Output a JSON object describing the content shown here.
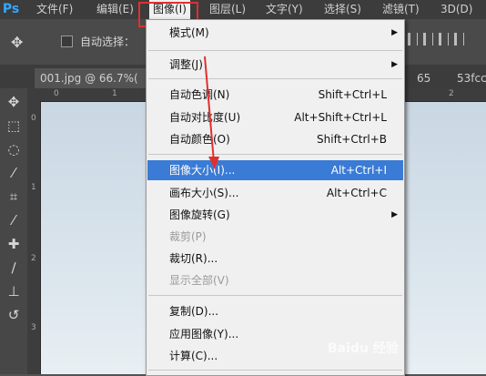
{
  "menubar": {
    "logo": "Ps",
    "items": [
      {
        "label": "文件(F)"
      },
      {
        "label": "编辑(E)"
      },
      {
        "label": "图像(I)"
      },
      {
        "label": "图层(L)"
      },
      {
        "label": "文字(Y)"
      },
      {
        "label": "选择(S)"
      },
      {
        "label": "滤镜(T)"
      },
      {
        "label": "3D(D)"
      }
    ]
  },
  "options": {
    "auto_select_label": "自动选择："
  },
  "tabs": {
    "doc_tab": "001.jpg @ 66.7%(",
    "other1": "65",
    "other2": "53fcc"
  },
  "rulers": {
    "top": [
      "0",
      "1",
      "2"
    ],
    "left": [
      "0",
      "1",
      "2",
      "3"
    ]
  },
  "image_menu": {
    "items": [
      {
        "label": "模式(M)",
        "shortcut": "",
        "submenu": true
      },
      {
        "label": "调整(J)",
        "shortcut": "",
        "submenu": true
      },
      {
        "label": "自动色调(N)",
        "shortcut": "Shift+Ctrl+L"
      },
      {
        "label": "自动对比度(U)",
        "shortcut": "Alt+Shift+Ctrl+L"
      },
      {
        "label": "自动颜色(O)",
        "shortcut": "Shift+Ctrl+B"
      },
      {
        "label": "图像大小(I)...",
        "shortcut": "Alt+Ctrl+I"
      },
      {
        "label": "画布大小(S)...",
        "shortcut": "Alt+Ctrl+C"
      },
      {
        "label": "图像旋转(G)",
        "shortcut": "",
        "submenu": true
      },
      {
        "label": "裁剪(P)",
        "shortcut": ""
      },
      {
        "label": "裁切(R)...",
        "shortcut": ""
      },
      {
        "label": "显示全部(V)",
        "shortcut": ""
      },
      {
        "label": "复制(D)...",
        "shortcut": ""
      },
      {
        "label": "应用图像(Y)...",
        "shortcut": ""
      },
      {
        "label": "计算(C)...",
        "shortcut": ""
      }
    ]
  },
  "watermark": "Baidu 经验",
  "colors": {
    "highlight": "#3a7bd5",
    "annotation_red": "#e03030"
  }
}
